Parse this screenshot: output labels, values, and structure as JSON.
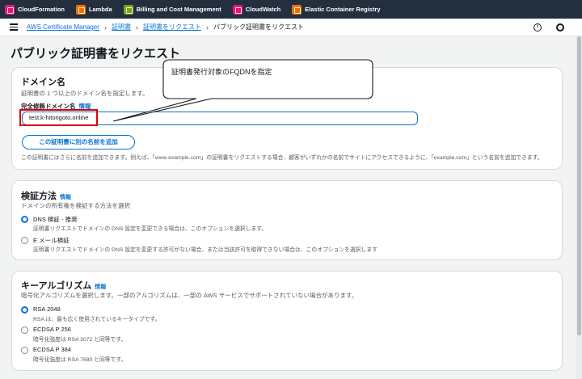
{
  "favorites": [
    {
      "label": "CloudFormation",
      "color": "#e7157b"
    },
    {
      "label": "Lambda",
      "color": "#ed7100"
    },
    {
      "label": "Billing and Cost Management",
      "color": "#7aa116"
    },
    {
      "label": "CloudWatch",
      "color": "#e7157b"
    },
    {
      "label": "Elastic Container Registry",
      "color": "#ed7100"
    }
  ],
  "breadcrumb": {
    "items": [
      "AWS Certificate Manager",
      "証明書",
      "証明書をリクエスト"
    ],
    "current": "パブリック証明書をリクエスト"
  },
  "page_title": "パブリック証明書をリクエスト",
  "callout": {
    "text": "証明書発行対象のFQDNを指定"
  },
  "domain_panel": {
    "title": "ドメイン名",
    "description": "証明書の 1 つ以上のドメイン名を指定します。",
    "field_label": "完全修飾ドメイン名",
    "info": "情報",
    "input_value": "test.k-hitorigoto.online",
    "add_button": "この証明書に別の名前を追加",
    "note": "この証明書にはさらに名前を追加できます。例えば、「www.example.com」の証明書をリクエストする場合、顧客がいずれかの名前でサイトにアクセスできるように、「example.com」という名前を追加できます。"
  },
  "validation_panel": {
    "title": "検証方法",
    "info": "情報",
    "description": "ドメインの所有権を検証する方法を選択",
    "options": [
      {
        "label": "DNS 検証 - 推奨",
        "desc": "証明書リクエストでドメインの DNS 設定を変更できる場合は、このオプションを選択します。",
        "selected": true
      },
      {
        "label": "E メール検証",
        "desc": "証明書リクエストでドメインの DNS 設定を変更する許可がない場合、または当該許可を取得できない場合は、このオプションを選択します",
        "selected": false
      }
    ]
  },
  "key_panel": {
    "title": "キーアルゴリズム",
    "info": "情報",
    "description": "暗号化アルゴリズムを選択します。一部のアルゴリズムは、一部の AWS サービスでサポートされていない場合があります。",
    "options": [
      {
        "label": "RSA 2048",
        "desc": "RSA は、最も広く使用されているキータイプです。",
        "selected": true
      },
      {
        "label": "ECDSA P 256",
        "desc": "暗号化強度は RSA 3072 と同等です。",
        "selected": false
      },
      {
        "label": "ECDSA P 384",
        "desc": "暗号化強度は RSA 7680 と同等です。",
        "selected": false
      }
    ]
  }
}
